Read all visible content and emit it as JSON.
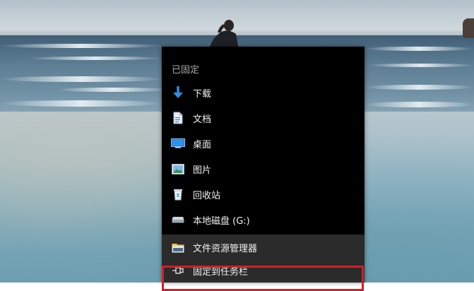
{
  "jump_list": {
    "pinned_header": "已固定",
    "pinned_items": [
      {
        "label": "下载",
        "icon": "download-arrow-icon"
      },
      {
        "label": "文档",
        "icon": "document-icon"
      },
      {
        "label": "桌面",
        "icon": "desktop-icon"
      },
      {
        "label": "图片",
        "icon": "pictures-icon"
      },
      {
        "label": "回收站",
        "icon": "recycle-bin-icon"
      },
      {
        "label": "本地磁盘 (G:)",
        "icon": "local-disk-icon"
      }
    ],
    "actions": [
      {
        "label": "文件资源管理器",
        "icon": "file-explorer-icon"
      },
      {
        "label": "固定到任务栏",
        "icon": "pin-icon"
      }
    ]
  },
  "colors": {
    "menu_background": "#000000",
    "actions_background": "#2b2b2b",
    "highlight_border": "#d0202a",
    "header_text": "#a9a9a9",
    "item_text": "#f2f2f2",
    "accent_blue": "#2f8ee6"
  }
}
